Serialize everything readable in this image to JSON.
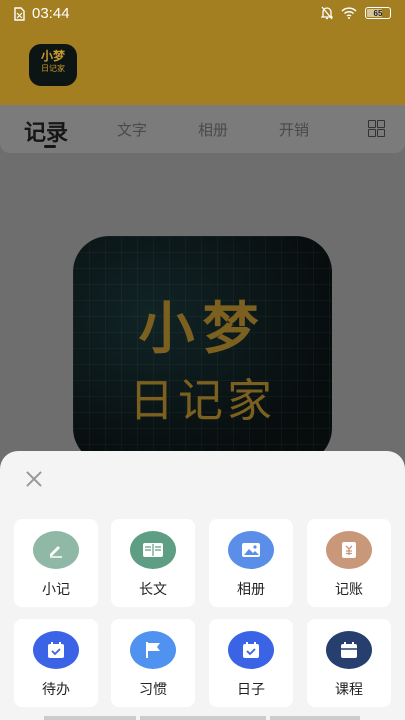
{
  "status": {
    "time": "03:44",
    "battery": "65"
  },
  "header": {
    "logo_line1": "小梦",
    "logo_line2": "日记家"
  },
  "tabs": [
    {
      "label": "记录"
    },
    {
      "label": "文字"
    },
    {
      "label": "相册"
    },
    {
      "label": "开销"
    }
  ],
  "center_logo": {
    "line1": "小梦",
    "line2": "日记家"
  },
  "sheet": {
    "items": [
      {
        "label": "小记",
        "icon": "pencil-icon",
        "color": "#8fb8a6"
      },
      {
        "label": "长文",
        "icon": "book-icon",
        "color": "#5e9e84"
      },
      {
        "label": "相册",
        "icon": "image-icon",
        "color": "#5b8ee8"
      },
      {
        "label": "记账",
        "icon": "yen-icon",
        "color": "#c9977a"
      },
      {
        "label": "待办",
        "icon": "calendar-check-icon",
        "color": "#3b63e6"
      },
      {
        "label": "习惯",
        "icon": "flag-icon",
        "color": "#4f92f0"
      },
      {
        "label": "日子",
        "icon": "calendar-check-icon",
        "color": "#3b63e6"
      },
      {
        "label": "课程",
        "icon": "calendar-icon",
        "color": "#263f6e"
      }
    ]
  }
}
